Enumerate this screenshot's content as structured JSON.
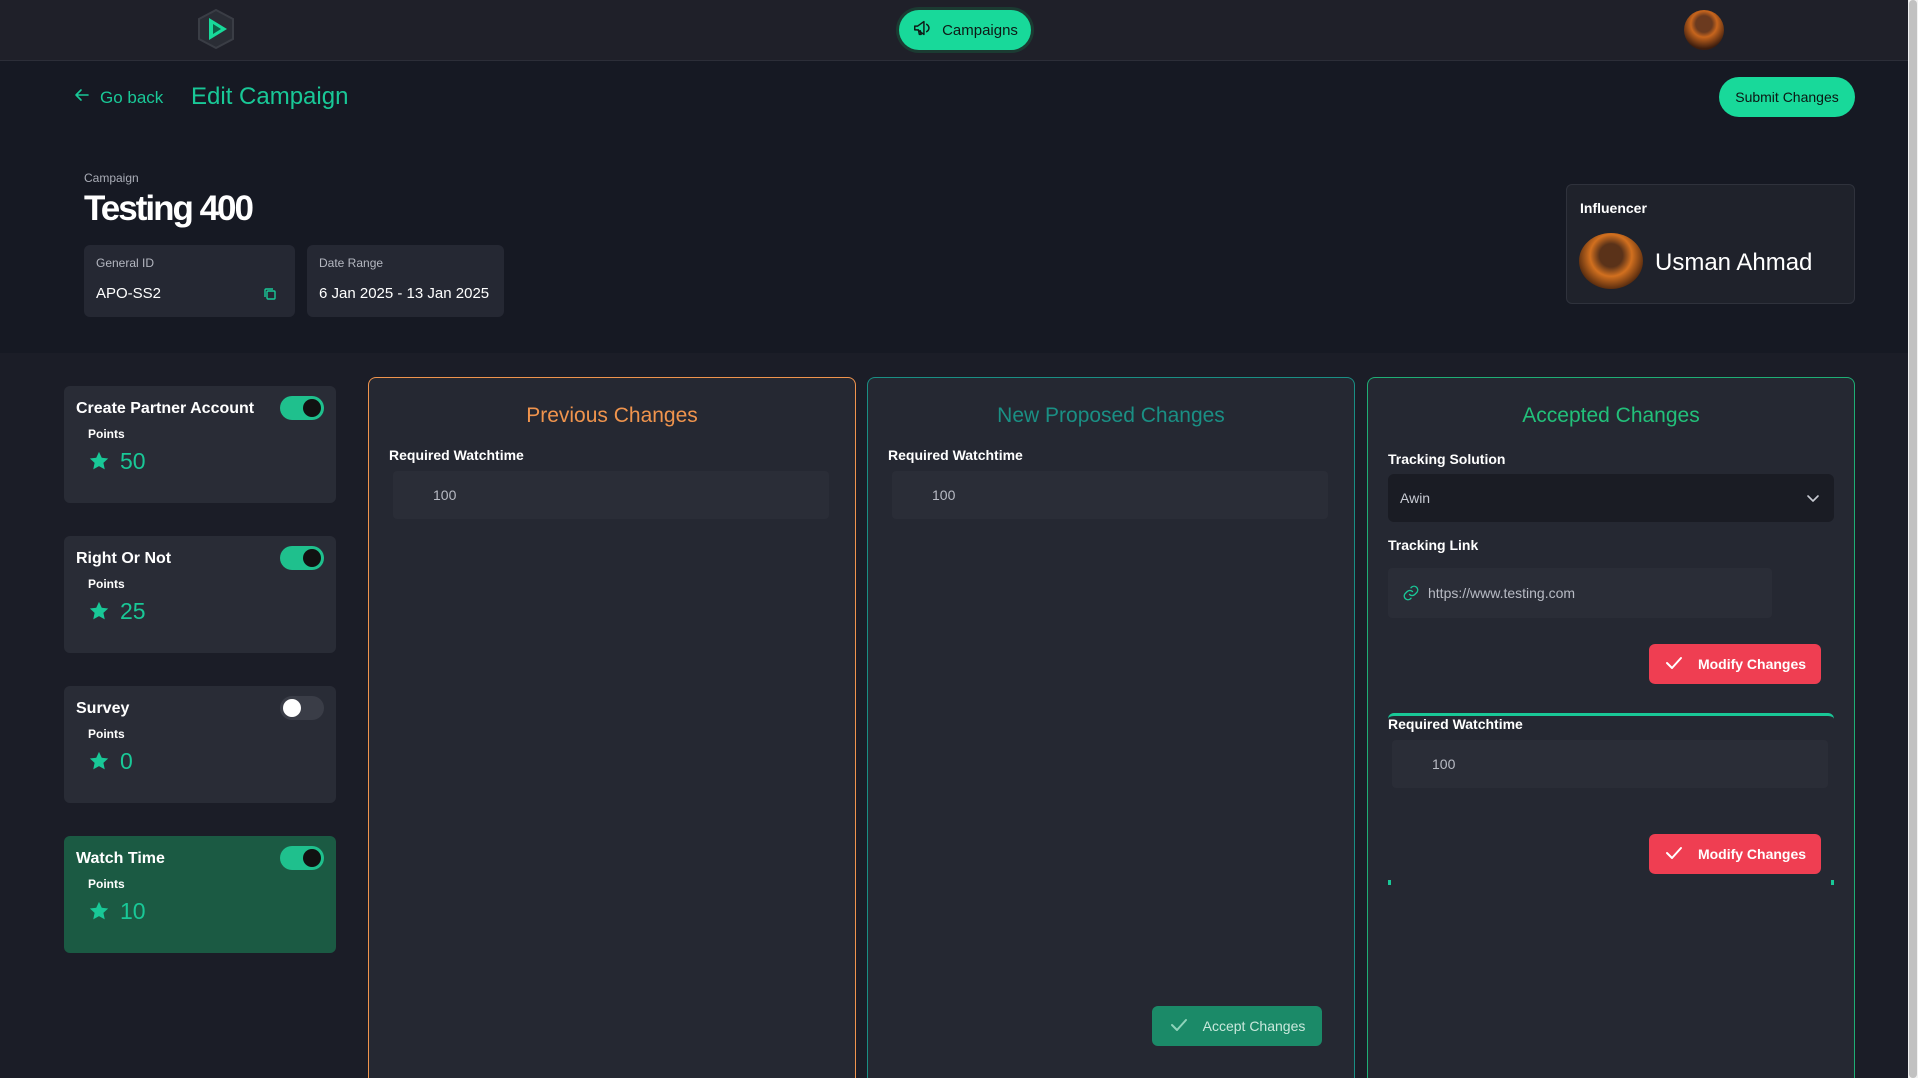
{
  "nav": {
    "campaigns_label": "Campaigns"
  },
  "header": {
    "back_label": "Go back",
    "page_title": "Edit Campaign",
    "submit_label": "Submit Changes",
    "campaign_label": "Campaign",
    "campaign_name": "Testing 400",
    "general_id_label": "General ID",
    "general_id_value": "APO-SS2",
    "date_range_label": "Date Range",
    "date_range_value": "6 Jan 2025 - 13 Jan 2025",
    "influencer_label": "Influencer",
    "influencer_name": "Usman Ahmad"
  },
  "tasks": [
    {
      "title": "Create Partner Account",
      "points_label": "Points",
      "points": "50",
      "enabled": true
    },
    {
      "title": "Right Or Not",
      "points_label": "Points",
      "points": "25",
      "enabled": true
    },
    {
      "title": "Survey",
      "points_label": "Points",
      "points": "0",
      "enabled": false
    },
    {
      "title": "Watch Time",
      "points_label": "Points",
      "points": "10",
      "enabled": true,
      "selected": true
    }
  ],
  "panels": {
    "previous": {
      "title": "Previous Changes",
      "watch_label": "Required Watchtime",
      "watch_value": "100"
    },
    "proposed": {
      "title": "New Proposed Changes",
      "watch_label": "Required Watchtime",
      "watch_value": "100",
      "accept_label": "Accept Changes"
    },
    "accepted": {
      "title": "Accepted Changes",
      "tracking_solution_label": "Tracking Solution",
      "tracking_solution_value": "Awin",
      "tracking_link_label": "Tracking Link",
      "tracking_link_value": "https://www.testing.com",
      "modify_label": "Modify Changes",
      "watch_label": "Required Watchtime",
      "watch_value": "100",
      "modify_label_2": "Modify Changes"
    }
  },
  "colors": {
    "accent": "#19c897",
    "previous_title": "#f0944d",
    "proposed_title": "#1a8f84",
    "accepted_title": "#22c07a",
    "danger": "#ef3e52"
  }
}
